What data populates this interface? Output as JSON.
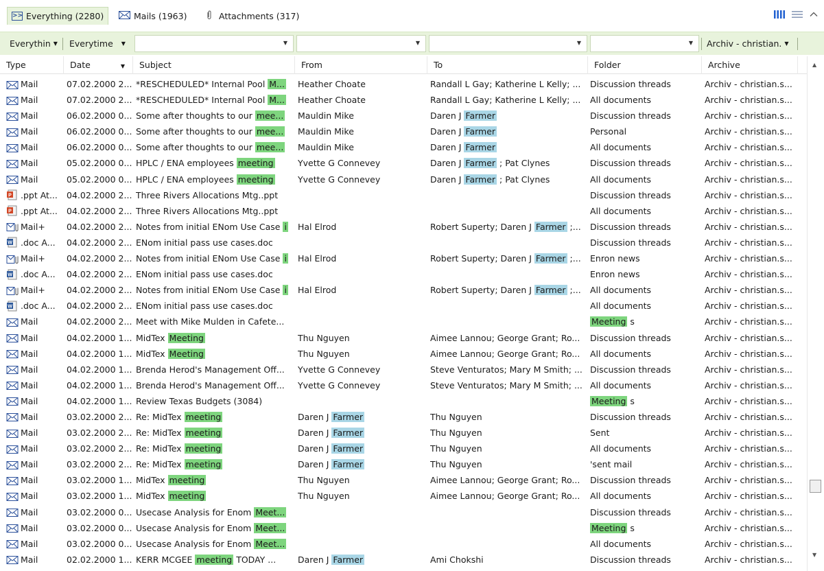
{
  "tabs": [
    {
      "label": "Everything (2280)",
      "icon": "everything-icon",
      "active": true
    },
    {
      "label": "Mails (1963)",
      "icon": "mail-icon",
      "active": false
    },
    {
      "label": "Attachments (317)",
      "icon": "paperclip-icon",
      "active": false
    }
  ],
  "view_icons": [
    "columns-view-icon",
    "list-view-icon",
    "collapse-chevron-up-icon"
  ],
  "filters": {
    "type": "Everythin",
    "time": "Everytime",
    "subject": "",
    "from": "",
    "to": "",
    "folder": "",
    "archive": "Archiv - christian."
  },
  "columns": [
    "Type",
    "Date",
    "Subject",
    "From",
    "To",
    "Folder",
    "Archive"
  ],
  "colors": {
    "accent": "#e8f3dc",
    "highlight_green": "#7ed57e",
    "highlight_blue": "#a9d6e6",
    "mail_icon": "#2a4f9a"
  },
  "rows": [
    {
      "icon": "mail-icon",
      "type": "Mail",
      "date": "07.02.2000 2...",
      "subject": [
        {
          "t": "*RESCHEDULED* Internal Pool "
        },
        {
          "t": "M...",
          "h": "g"
        }
      ],
      "from": [
        {
          "t": "Heather Choate"
        }
      ],
      "to": [
        {
          "t": "Randall L Gay; Katherine L Kelly; ..."
        }
      ],
      "folder": [
        {
          "t": "Discussion threads"
        }
      ],
      "archive": "Archiv - christian.s..."
    },
    {
      "icon": "mail-icon",
      "type": "Mail",
      "date": "07.02.2000 2...",
      "subject": [
        {
          "t": "*RESCHEDULED* Internal Pool "
        },
        {
          "t": "M...",
          "h": "g"
        }
      ],
      "from": [
        {
          "t": "Heather Choate"
        }
      ],
      "to": [
        {
          "t": "Randall L Gay; Katherine L Kelly; ..."
        }
      ],
      "folder": [
        {
          "t": "All documents"
        }
      ],
      "archive": "Archiv - christian.s..."
    },
    {
      "icon": "mail-icon",
      "type": "Mail",
      "date": "06.02.2000 0...",
      "subject": [
        {
          "t": "Some after thoughts to our "
        },
        {
          "t": "mee...",
          "h": "g"
        }
      ],
      "from": [
        {
          "t": "Mauldin Mike"
        }
      ],
      "to": [
        {
          "t": "Daren J "
        },
        {
          "t": "Farmer",
          "h": "b"
        }
      ],
      "folder": [
        {
          "t": "Discussion threads"
        }
      ],
      "archive": "Archiv - christian.s..."
    },
    {
      "icon": "mail-icon",
      "type": "Mail",
      "date": "06.02.2000 0...",
      "subject": [
        {
          "t": "Some after thoughts to our "
        },
        {
          "t": "mee...",
          "h": "g"
        }
      ],
      "from": [
        {
          "t": "Mauldin Mike"
        }
      ],
      "to": [
        {
          "t": "Daren J "
        },
        {
          "t": "Farmer",
          "h": "b"
        }
      ],
      "folder": [
        {
          "t": "Personal"
        }
      ],
      "archive": "Archiv - christian.s..."
    },
    {
      "icon": "mail-icon",
      "type": "Mail",
      "date": "06.02.2000 0...",
      "subject": [
        {
          "t": "Some after thoughts to our "
        },
        {
          "t": "mee...",
          "h": "g"
        }
      ],
      "from": [
        {
          "t": "Mauldin Mike"
        }
      ],
      "to": [
        {
          "t": "Daren J "
        },
        {
          "t": "Farmer",
          "h": "b"
        }
      ],
      "folder": [
        {
          "t": "All documents"
        }
      ],
      "archive": "Archiv - christian.s..."
    },
    {
      "icon": "mail-icon",
      "type": "Mail",
      "date": "05.02.2000 0...",
      "subject": [
        {
          "t": "HPLC / ENA employees "
        },
        {
          "t": "meeting",
          "h": "g"
        }
      ],
      "from": [
        {
          "t": "Yvette G Connevey"
        }
      ],
      "to": [
        {
          "t": "Daren J "
        },
        {
          "t": "Farmer",
          "h": "b"
        },
        {
          "t": " ; Pat Clynes"
        }
      ],
      "folder": [
        {
          "t": "Discussion threads"
        }
      ],
      "archive": "Archiv - christian.s..."
    },
    {
      "icon": "mail-icon",
      "type": "Mail",
      "date": "05.02.2000 0...",
      "subject": [
        {
          "t": "HPLC / ENA employees "
        },
        {
          "t": "meeting",
          "h": "g"
        }
      ],
      "from": [
        {
          "t": "Yvette G Connevey"
        }
      ],
      "to": [
        {
          "t": "Daren J "
        },
        {
          "t": "Farmer",
          "h": "b"
        },
        {
          "t": " ; Pat Clynes"
        }
      ],
      "folder": [
        {
          "t": "All documents"
        }
      ],
      "archive": "Archiv - christian.s..."
    },
    {
      "icon": "ppt-icon",
      "type": ".ppt At...",
      "date": "04.02.2000 2...",
      "subject": [
        {
          "t": "Three Rivers Allocations Mtg..ppt"
        }
      ],
      "from": [],
      "to": [],
      "folder": [
        {
          "t": "Discussion threads"
        }
      ],
      "archive": "Archiv - christian.s..."
    },
    {
      "icon": "ppt-icon",
      "type": ".ppt At...",
      "date": "04.02.2000 2...",
      "subject": [
        {
          "t": "Three Rivers Allocations Mtg..ppt"
        }
      ],
      "from": [],
      "to": [],
      "folder": [
        {
          "t": "All documents"
        }
      ],
      "archive": "Archiv - christian.s..."
    },
    {
      "icon": "mail-attachment-icon",
      "type": "Mail+",
      "date": "04.02.2000 2...",
      "subject": [
        {
          "t": "Notes from initial ENom Use Case "
        },
        {
          "t": "i",
          "h": "g"
        }
      ],
      "from": [
        {
          "t": "Hal Elrod"
        }
      ],
      "to": [
        {
          "t": "Robert Superty; Daren J "
        },
        {
          "t": "Farmer",
          "h": "b"
        },
        {
          "t": " ;..."
        }
      ],
      "folder": [
        {
          "t": "Discussion threads"
        }
      ],
      "archive": "Archiv - christian.s..."
    },
    {
      "icon": "doc-icon",
      "type": ".doc A...",
      "date": "04.02.2000 2...",
      "subject": [
        {
          "t": "ENom initial pass use cases.doc"
        }
      ],
      "from": [],
      "to": [],
      "folder": [
        {
          "t": "Discussion threads"
        }
      ],
      "archive": "Archiv - christian.s..."
    },
    {
      "icon": "mail-attachment-icon",
      "type": "Mail+",
      "date": "04.02.2000 2...",
      "subject": [
        {
          "t": "Notes from initial ENom Use Case "
        },
        {
          "t": "i",
          "h": "g"
        }
      ],
      "from": [
        {
          "t": "Hal Elrod"
        }
      ],
      "to": [
        {
          "t": "Robert Superty; Daren J "
        },
        {
          "t": "Farmer",
          "h": "b"
        },
        {
          "t": " ;..."
        }
      ],
      "folder": [
        {
          "t": "Enron news"
        }
      ],
      "archive": "Archiv - christian.s..."
    },
    {
      "icon": "doc-icon",
      "type": ".doc A...",
      "date": "04.02.2000 2...",
      "subject": [
        {
          "t": "ENom initial pass use cases.doc"
        }
      ],
      "from": [],
      "to": [],
      "folder": [
        {
          "t": "Enron news"
        }
      ],
      "archive": "Archiv - christian.s..."
    },
    {
      "icon": "mail-attachment-icon",
      "type": "Mail+",
      "date": "04.02.2000 2...",
      "subject": [
        {
          "t": "Notes from initial ENom Use Case "
        },
        {
          "t": "i",
          "h": "g"
        }
      ],
      "from": [
        {
          "t": "Hal Elrod"
        }
      ],
      "to": [
        {
          "t": "Robert Superty; Daren J "
        },
        {
          "t": "Farmer",
          "h": "b"
        },
        {
          "t": " ;..."
        }
      ],
      "folder": [
        {
          "t": "All documents"
        }
      ],
      "archive": "Archiv - christian.s..."
    },
    {
      "icon": "doc-icon",
      "type": ".doc A...",
      "date": "04.02.2000 2...",
      "subject": [
        {
          "t": "ENom initial pass use cases.doc"
        }
      ],
      "from": [],
      "to": [],
      "folder": [
        {
          "t": "All documents"
        }
      ],
      "archive": "Archiv - christian.s..."
    },
    {
      "icon": "mail-icon",
      "type": "Mail",
      "date": "04.02.2000 2...",
      "subject": [
        {
          "t": "Meet with Mike Mulden in Cafete..."
        }
      ],
      "from": [],
      "to": [],
      "folder": [
        {
          "t": "Meeting",
          "h": "g"
        },
        {
          "t": " s"
        }
      ],
      "archive": "Archiv - christian.s..."
    },
    {
      "icon": "mail-icon",
      "type": "Mail",
      "date": "04.02.2000 1...",
      "subject": [
        {
          "t": "MidTex "
        },
        {
          "t": "Meeting",
          "h": "g"
        }
      ],
      "from": [
        {
          "t": "Thu Nguyen"
        }
      ],
      "to": [
        {
          "t": "Aimee Lannou; George Grant; Ro..."
        }
      ],
      "folder": [
        {
          "t": "Discussion threads"
        }
      ],
      "archive": "Archiv - christian.s..."
    },
    {
      "icon": "mail-icon",
      "type": "Mail",
      "date": "04.02.2000 1...",
      "subject": [
        {
          "t": "MidTex "
        },
        {
          "t": "Meeting",
          "h": "g"
        }
      ],
      "from": [
        {
          "t": "Thu Nguyen"
        }
      ],
      "to": [
        {
          "t": "Aimee Lannou; George Grant; Ro..."
        }
      ],
      "folder": [
        {
          "t": "All documents"
        }
      ],
      "archive": "Archiv - christian.s..."
    },
    {
      "icon": "mail-icon",
      "type": "Mail",
      "date": "04.02.2000 1...",
      "subject": [
        {
          "t": "Brenda Herod's Management Off..."
        }
      ],
      "from": [
        {
          "t": "Yvette G Connevey"
        }
      ],
      "to": [
        {
          "t": "Steve Venturatos; Mary M Smith; ..."
        }
      ],
      "folder": [
        {
          "t": "Discussion threads"
        }
      ],
      "archive": "Archiv - christian.s..."
    },
    {
      "icon": "mail-icon",
      "type": "Mail",
      "date": "04.02.2000 1...",
      "subject": [
        {
          "t": "Brenda Herod's Management Off..."
        }
      ],
      "from": [
        {
          "t": "Yvette G Connevey"
        }
      ],
      "to": [
        {
          "t": "Steve Venturatos; Mary M Smith; ..."
        }
      ],
      "folder": [
        {
          "t": "All documents"
        }
      ],
      "archive": "Archiv - christian.s..."
    },
    {
      "icon": "mail-icon",
      "type": "Mail",
      "date": "04.02.2000 1...",
      "subject": [
        {
          "t": "Review Texas Budgets (3084)"
        }
      ],
      "from": [],
      "to": [],
      "folder": [
        {
          "t": "Meeting",
          "h": "g"
        },
        {
          "t": " s"
        }
      ],
      "archive": "Archiv - christian.s..."
    },
    {
      "icon": "mail-icon",
      "type": "Mail",
      "date": "03.02.2000 2...",
      "subject": [
        {
          "t": "Re: MidTex "
        },
        {
          "t": "meeting",
          "h": "g"
        }
      ],
      "from": [
        {
          "t": "Daren J "
        },
        {
          "t": "Farmer",
          "h": "b"
        }
      ],
      "to": [
        {
          "t": "Thu Nguyen"
        }
      ],
      "folder": [
        {
          "t": "Discussion threads"
        }
      ],
      "archive": "Archiv - christian.s..."
    },
    {
      "icon": "mail-icon",
      "type": "Mail",
      "date": "03.02.2000 2...",
      "subject": [
        {
          "t": "Re: MidTex "
        },
        {
          "t": "meeting",
          "h": "g"
        }
      ],
      "from": [
        {
          "t": "Daren J "
        },
        {
          "t": "Farmer",
          "h": "b"
        }
      ],
      "to": [
        {
          "t": "Thu Nguyen"
        }
      ],
      "folder": [
        {
          "t": "Sent"
        }
      ],
      "archive": "Archiv - christian.s..."
    },
    {
      "icon": "mail-icon",
      "type": "Mail",
      "date": "03.02.2000 2...",
      "subject": [
        {
          "t": "Re: MidTex "
        },
        {
          "t": "meeting",
          "h": "g"
        }
      ],
      "from": [
        {
          "t": "Daren J "
        },
        {
          "t": "Farmer",
          "h": "b"
        }
      ],
      "to": [
        {
          "t": "Thu Nguyen"
        }
      ],
      "folder": [
        {
          "t": "All documents"
        }
      ],
      "archive": "Archiv - christian.s..."
    },
    {
      "icon": "mail-icon",
      "type": "Mail",
      "date": "03.02.2000 2...",
      "subject": [
        {
          "t": "Re: MidTex "
        },
        {
          "t": "meeting",
          "h": "g"
        }
      ],
      "from": [
        {
          "t": "Daren J "
        },
        {
          "t": "Farmer",
          "h": "b"
        }
      ],
      "to": [
        {
          "t": "Thu Nguyen"
        }
      ],
      "folder": [
        {
          "t": "'sent mail"
        }
      ],
      "archive": "Archiv - christian.s..."
    },
    {
      "icon": "mail-icon",
      "type": "Mail",
      "date": "03.02.2000 1...",
      "subject": [
        {
          "t": "MidTex "
        },
        {
          "t": "meeting",
          "h": "g"
        }
      ],
      "from": [
        {
          "t": "Thu Nguyen"
        }
      ],
      "to": [
        {
          "t": "Aimee Lannou; George Grant; Ro..."
        }
      ],
      "folder": [
        {
          "t": "Discussion threads"
        }
      ],
      "archive": "Archiv - christian.s..."
    },
    {
      "icon": "mail-icon",
      "type": "Mail",
      "date": "03.02.2000 1...",
      "subject": [
        {
          "t": "MidTex "
        },
        {
          "t": "meeting",
          "h": "g"
        }
      ],
      "from": [
        {
          "t": "Thu Nguyen"
        }
      ],
      "to": [
        {
          "t": "Aimee Lannou; George Grant; Ro..."
        }
      ],
      "folder": [
        {
          "t": "All documents"
        }
      ],
      "archive": "Archiv - christian.s..."
    },
    {
      "icon": "mail-icon",
      "type": "Mail",
      "date": "03.02.2000 0...",
      "subject": [
        {
          "t": "Usecase Analysis for Enom "
        },
        {
          "t": "Meet...",
          "h": "g"
        }
      ],
      "from": [],
      "to": [],
      "folder": [
        {
          "t": "Discussion threads"
        }
      ],
      "archive": "Archiv - christian.s..."
    },
    {
      "icon": "mail-icon",
      "type": "Mail",
      "date": "03.02.2000 0...",
      "subject": [
        {
          "t": "Usecase Analysis for Enom "
        },
        {
          "t": "Meet...",
          "h": "g"
        }
      ],
      "from": [],
      "to": [],
      "folder": [
        {
          "t": "Meeting",
          "h": "g"
        },
        {
          "t": " s"
        }
      ],
      "archive": "Archiv - christian.s..."
    },
    {
      "icon": "mail-icon",
      "type": "Mail",
      "date": "03.02.2000 0...",
      "subject": [
        {
          "t": "Usecase Analysis for Enom "
        },
        {
          "t": "Meet...",
          "h": "g"
        }
      ],
      "from": [],
      "to": [],
      "folder": [
        {
          "t": "All documents"
        }
      ],
      "archive": "Archiv - christian.s..."
    },
    {
      "icon": "mail-icon",
      "type": "Mail",
      "date": "02.02.2000 1...",
      "subject": [
        {
          "t": "KERR MCGEE "
        },
        {
          "t": "meeting",
          "h": "g"
        },
        {
          "t": " TODAY ..."
        }
      ],
      "from": [
        {
          "t": "Daren J "
        },
        {
          "t": "Farmer",
          "h": "b"
        }
      ],
      "to": [
        {
          "t": "Ami Chokshi"
        }
      ],
      "folder": [
        {
          "t": "Discussion threads"
        }
      ],
      "archive": "Archiv - christian.s..."
    }
  ]
}
